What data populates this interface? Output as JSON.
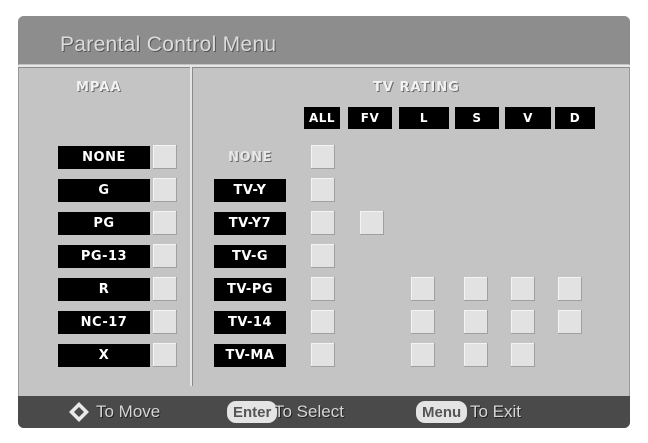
{
  "menu": {
    "title": "Parental Control Menu"
  },
  "mpaa": {
    "heading": "MPAA",
    "ratings": [
      "NONE",
      "G",
      "PG",
      "PG-13",
      "R",
      "NC-17",
      "X"
    ]
  },
  "tv": {
    "heading": "TV RATING",
    "columns": [
      "ALL",
      "FV",
      "L",
      "S",
      "V",
      "D"
    ],
    "ratings": [
      "NONE",
      "TV-Y",
      "TV-Y7",
      "TV-G",
      "TV-PG",
      "TV-14",
      "TV-MA"
    ]
  },
  "footer": {
    "move_text": "To Move",
    "enter_key": "Enter",
    "select_text": "To Select",
    "menu_key": "Menu",
    "exit_text": "To Exit"
  },
  "colors": {
    "screen_bg": "#c4c4c4",
    "label_bg": "#000000",
    "checkbox": "#e2e2e2",
    "footer_bg": "#4a4a4a"
  }
}
